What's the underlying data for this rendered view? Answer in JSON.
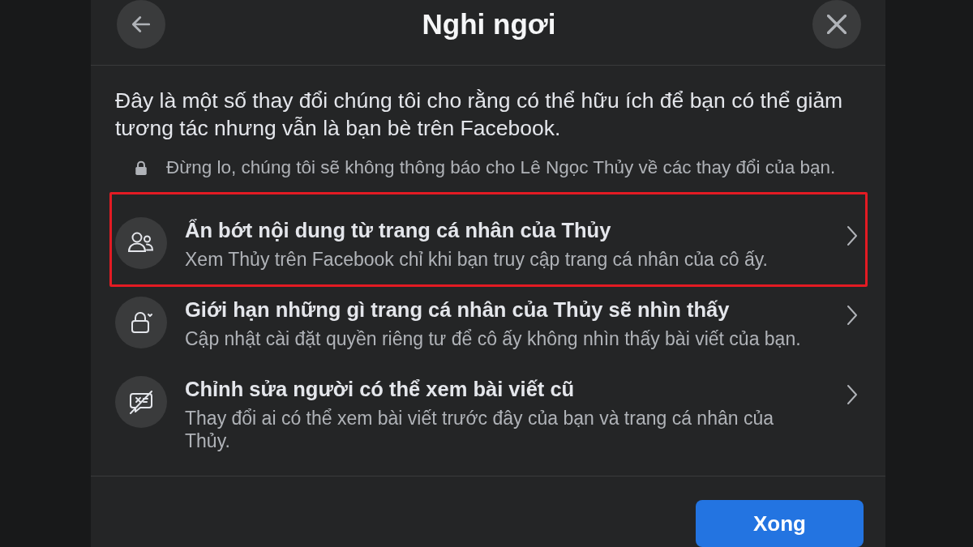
{
  "dialog": {
    "title": "Nghi ngơi",
    "intro": "Đây là một số thay đổi chúng tôi cho rằng có thể hữu ích để bạn có thể giảm tương tác nhưng vẫn là bạn bè trên Facebook.",
    "note": "Đừng lo, chúng tôi sẽ không thông báo cho Lê Ngọc Thủy về các thay đổi của bạn.",
    "options": [
      {
        "kind": "people",
        "title": "Ẩn bớt nội dung từ trang cá nhân của Thủy",
        "description": "Xem Thủy trên Facebook chỉ khi bạn truy cập trang cá nhân của cô ấy.",
        "highlighted": true
      },
      {
        "kind": "lock",
        "title": "Giới hạn những gì trang cá nhân của Thủy sẽ nhìn thấy",
        "description": "Cập nhật cài đặt quyền riêng tư để cô ấy không nhìn thấy bài viết của bạn.",
        "highlighted": false
      },
      {
        "kind": "hidden-post",
        "title": "Chỉnh sửa người có thể xem bài viết cũ",
        "description": "Thay đổi ai có thể xem bài viết trước đây của bạn và trang cá nhân của Thủy.",
        "highlighted": false
      }
    ],
    "done_button": "Xong"
  }
}
